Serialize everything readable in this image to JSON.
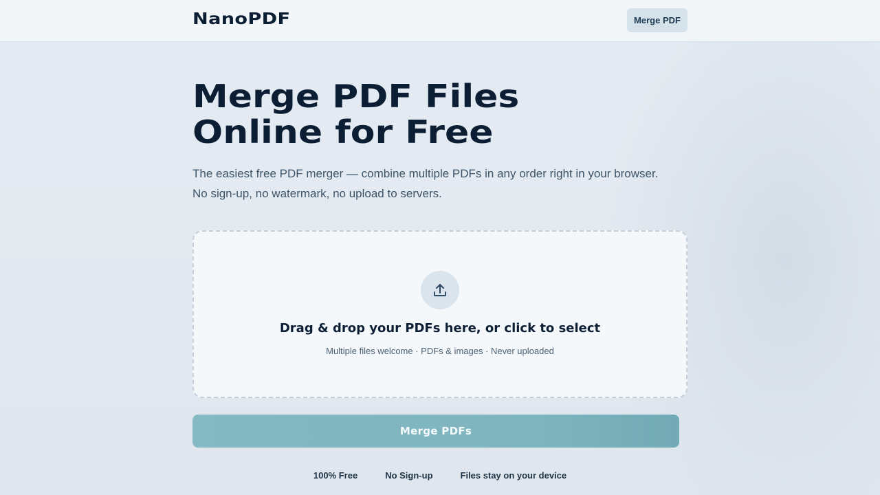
{
  "header": {
    "logo": "NanoPDF",
    "nav_button": "Merge PDF"
  },
  "hero": {
    "title_line1": "Merge PDF Files",
    "title_line2": "Online for Free",
    "subtitle_line1": "The easiest free PDF merger — combine multiple PDFs in any order right in your browser.",
    "subtitle_line2": "No sign-up, no watermark, no upload to servers."
  },
  "dropzone": {
    "icon": "upload-icon",
    "title": "Drag & drop your PDFs here, or click to select",
    "hint": "Multiple files welcome · PDFs & images · Never uploaded"
  },
  "merge_button": "Merge PDFs",
  "features": [
    "100% Free",
    "No Sign-up",
    "Files stay on your device"
  ],
  "colors": {
    "accent": "#7eb4be",
    "text_dark": "#0b1e33",
    "background": "#e4ebf2"
  }
}
